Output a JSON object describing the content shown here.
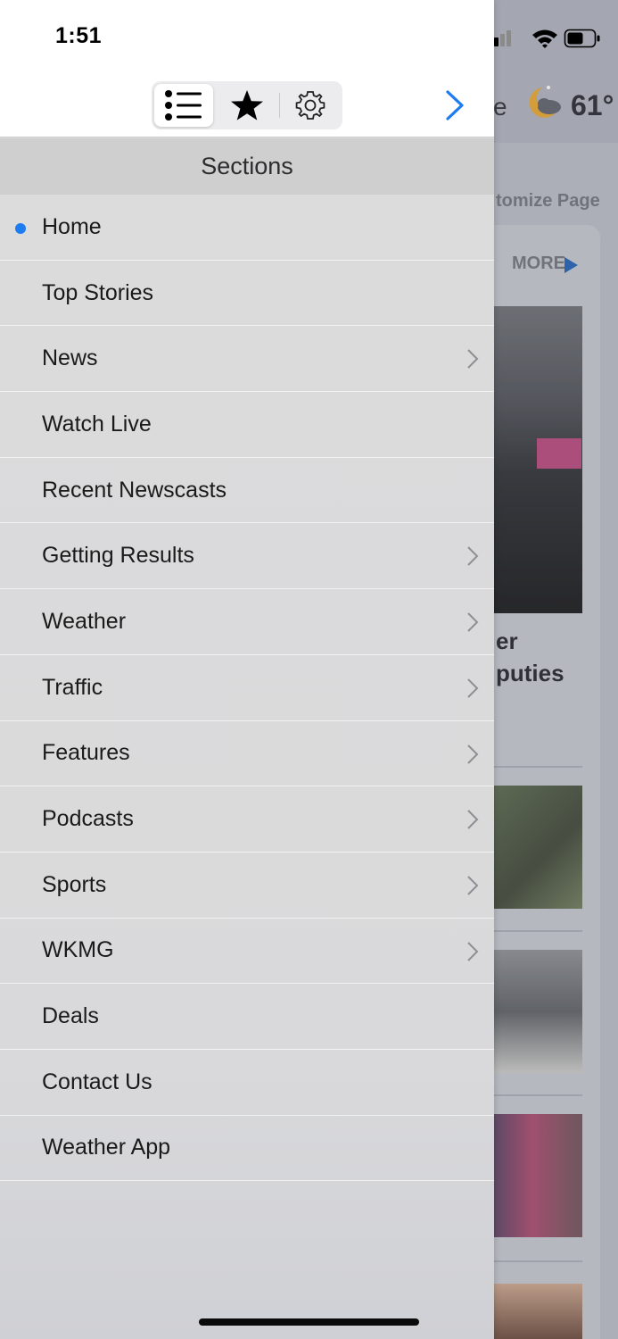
{
  "status_bar": {
    "time": "1:51"
  },
  "background_page": {
    "title_partial": "e",
    "temperature": "61°",
    "customize_partial": "tomize Page",
    "more_label": "MORE",
    "headline_partial": "er\nputies"
  },
  "toolbar": {
    "segments": [
      {
        "icon": "list-icon",
        "selected": true
      },
      {
        "icon": "star-icon",
        "selected": false
      },
      {
        "icon": "gear-icon",
        "selected": false
      }
    ],
    "accent_color": "#1c7cf0"
  },
  "sections": {
    "header": "Sections",
    "items": [
      {
        "label": "Home",
        "active": true,
        "has_children": false
      },
      {
        "label": "Top Stories",
        "active": false,
        "has_children": false
      },
      {
        "label": "News",
        "active": false,
        "has_children": true
      },
      {
        "label": "Watch Live",
        "active": false,
        "has_children": false
      },
      {
        "label": "Recent Newscasts",
        "active": false,
        "has_children": false
      },
      {
        "label": "Getting Results",
        "active": false,
        "has_children": true
      },
      {
        "label": "Weather",
        "active": false,
        "has_children": true
      },
      {
        "label": "Traffic",
        "active": false,
        "has_children": true
      },
      {
        "label": "Features",
        "active": false,
        "has_children": true
      },
      {
        "label": "Podcasts",
        "active": false,
        "has_children": true
      },
      {
        "label": "Sports",
        "active": false,
        "has_children": true
      },
      {
        "label": "WKMG",
        "active": false,
        "has_children": true
      },
      {
        "label": "Deals",
        "active": false,
        "has_children": false
      },
      {
        "label": "Contact Us",
        "active": false,
        "has_children": false
      },
      {
        "label": "Weather App",
        "active": false,
        "has_children": false
      }
    ]
  }
}
